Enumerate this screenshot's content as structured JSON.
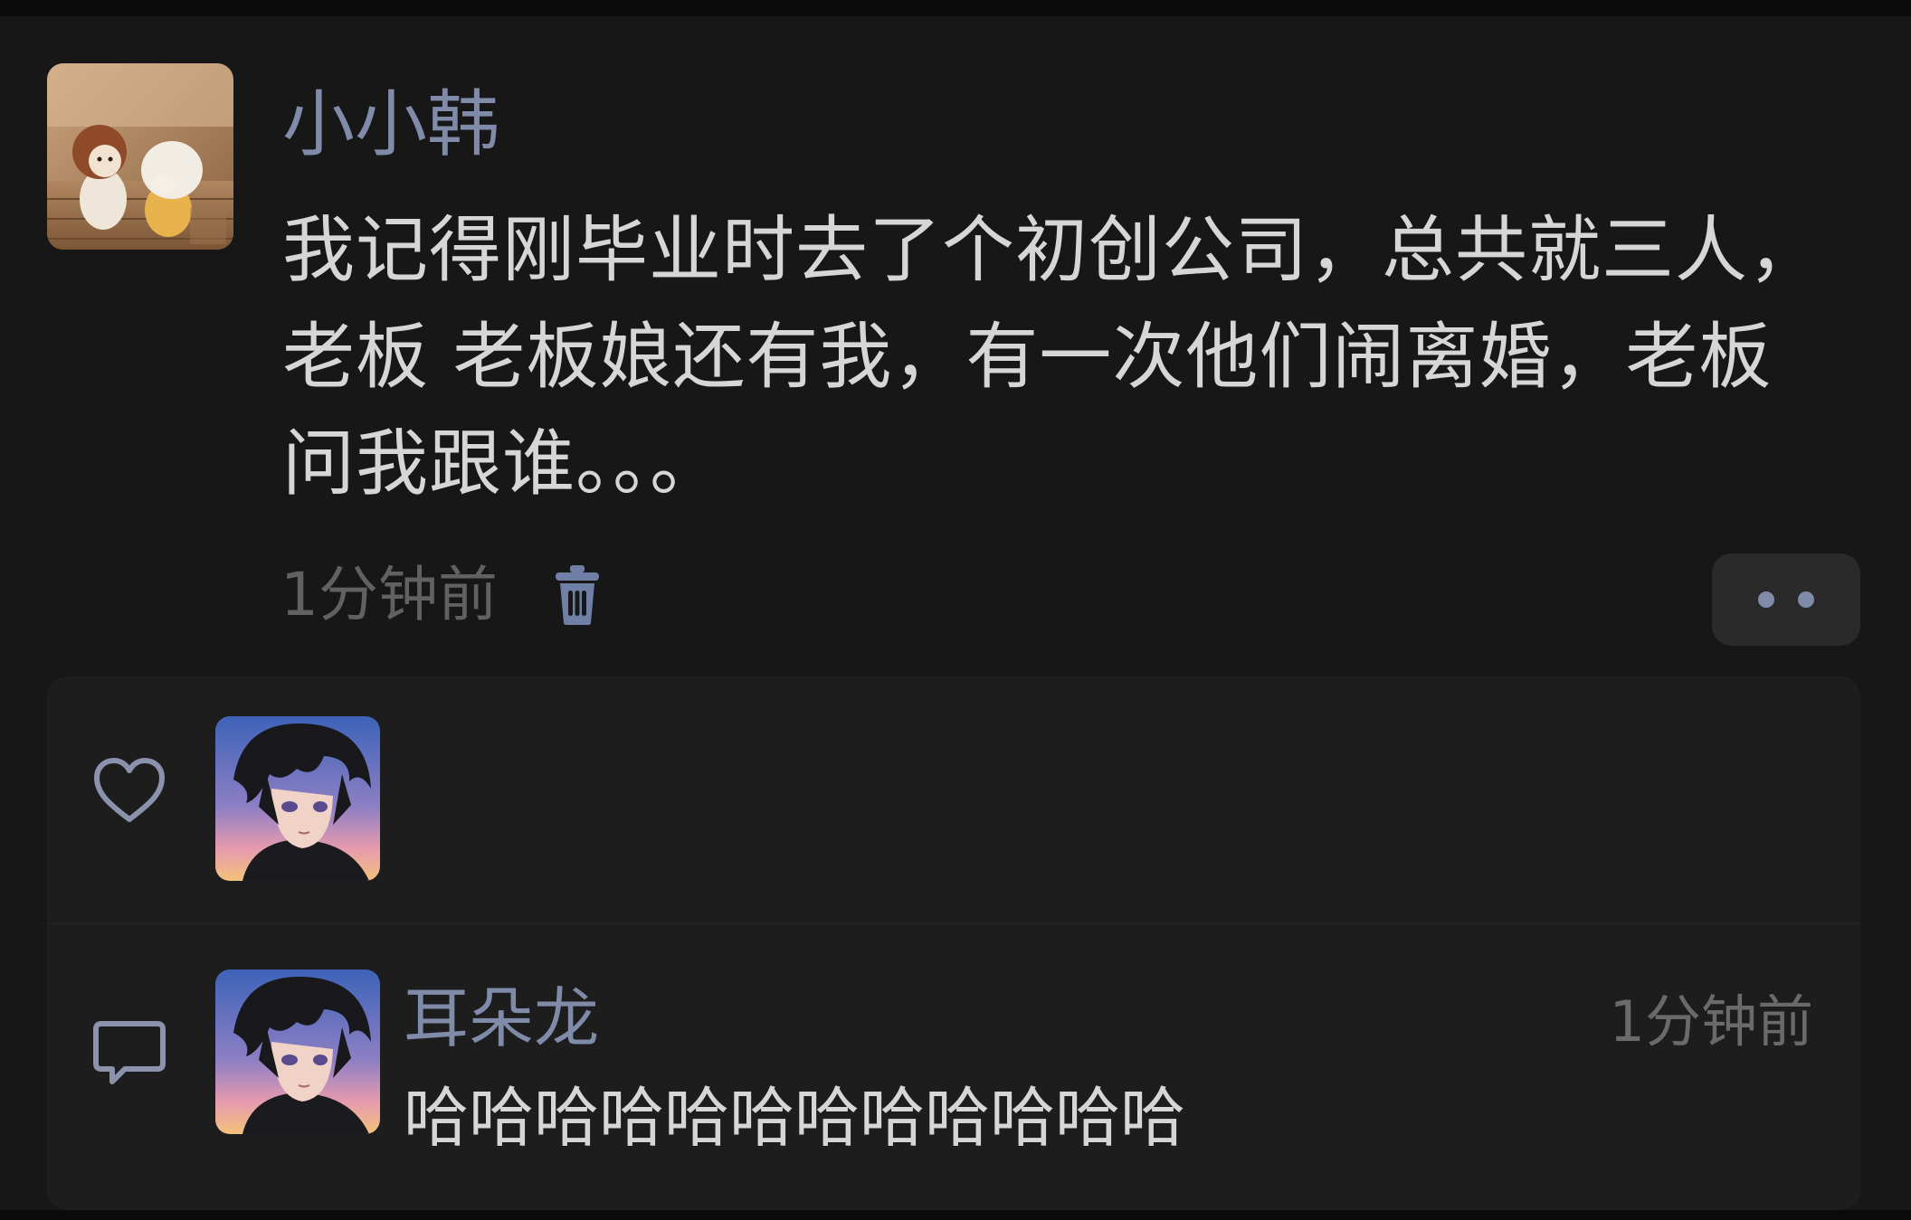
{
  "post": {
    "author": "小小韩",
    "body": "我记得刚毕业时去了个初创公司，总共就三人，老板 老板娘还有我，有一次他们闹离婚，老板问我跟谁。。。",
    "time": "1分钟前",
    "avatar_icon": "avatar-figurines-photo",
    "delete_icon": "trash-icon",
    "more_icon": "more-dots-icon"
  },
  "likes": {
    "icon": "heart-icon",
    "users": [
      {
        "avatar_icon": "avatar-anime-boy"
      }
    ]
  },
  "comments": [
    {
      "icon": "comment-bubble-icon",
      "author": "耳朵龙",
      "time": "1分钟前",
      "text": "哈哈哈哈哈哈哈哈哈哈哈哈",
      "avatar_icon": "avatar-anime-boy"
    }
  ],
  "colors": {
    "background": "#171717",
    "panel": "#1d1d1e",
    "name": "#7f8ba8",
    "text": "#d6d6d6",
    "muted": "#616161",
    "button": "#2a2a2b"
  }
}
